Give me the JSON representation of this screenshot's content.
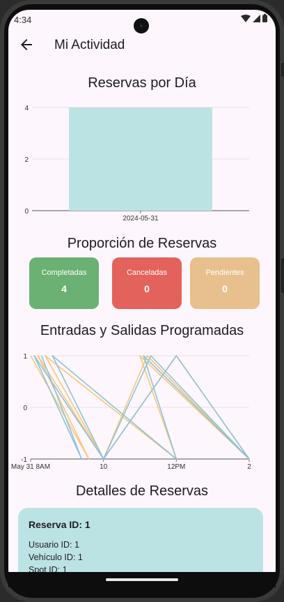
{
  "status_bar": {
    "time": "4:34"
  },
  "appbar": {
    "title": "Mi Actividad"
  },
  "sections": {
    "reservas_por_dia": "Reservas por Día",
    "proporcion": "Proporción de Reservas",
    "entradas_salidas": "Entradas y Salidas Programadas",
    "detalles": "Detalles de Reservas"
  },
  "stats": [
    {
      "label": "Completadas",
      "value": "4",
      "color": "#6ab173"
    },
    {
      "label": "Canceladas",
      "value": "0",
      "color": "#e4625c"
    },
    {
      "label": "Pendientes",
      "value": "0",
      "color": "#e7c08d"
    }
  ],
  "reservation": {
    "title": "Reserva ID: 1",
    "lines": [
      "Usuario ID: 1",
      "Vehículo ID: 1",
      "Spot ID: 1"
    ]
  },
  "chart_data": [
    {
      "type": "bar",
      "categories": [
        "2024-05-31"
      ],
      "values": [
        4
      ],
      "ylim": [
        0,
        4
      ],
      "yticks": [
        "0",
        "2",
        "4"
      ],
      "grid": true,
      "color": "#bce3e4"
    },
    {
      "type": "line",
      "ylim": [
        -1,
        1
      ],
      "yticks": [
        "-1",
        "0",
        "1"
      ],
      "xticks": [
        "May 31 8AM",
        "10",
        "12PM",
        "2"
      ],
      "grid": true,
      "series": [
        {
          "color": "#f6c77a",
          "points": [
            [
              8.0,
              1
            ],
            [
              9.6,
              -1
            ],
            [
              8.2,
              1
            ],
            [
              10.0,
              -1
            ],
            [
              8.4,
              1
            ],
            [
              12.0,
              -1
            ],
            [
              11.0,
              1
            ],
            [
              14.0,
              -1
            ],
            [
              12.0,
              1
            ],
            [
              10.0,
              -1
            ],
            [
              11.2,
              1
            ],
            [
              14.0,
              -1
            ]
          ]
        },
        {
          "color": "#8ec3d6",
          "points": [
            [
              8.3,
              1
            ],
            [
              9.4,
              -1
            ],
            [
              8.1,
              1
            ],
            [
              10.0,
              -1
            ],
            [
              8.6,
              1
            ],
            [
              12.0,
              -1
            ],
            [
              11.1,
              1
            ],
            [
              14.0,
              -1
            ],
            [
              12.0,
              1
            ],
            [
              10.0,
              -1
            ],
            [
              11.3,
              1
            ],
            [
              14.0,
              -1
            ]
          ]
        }
      ]
    }
  ]
}
